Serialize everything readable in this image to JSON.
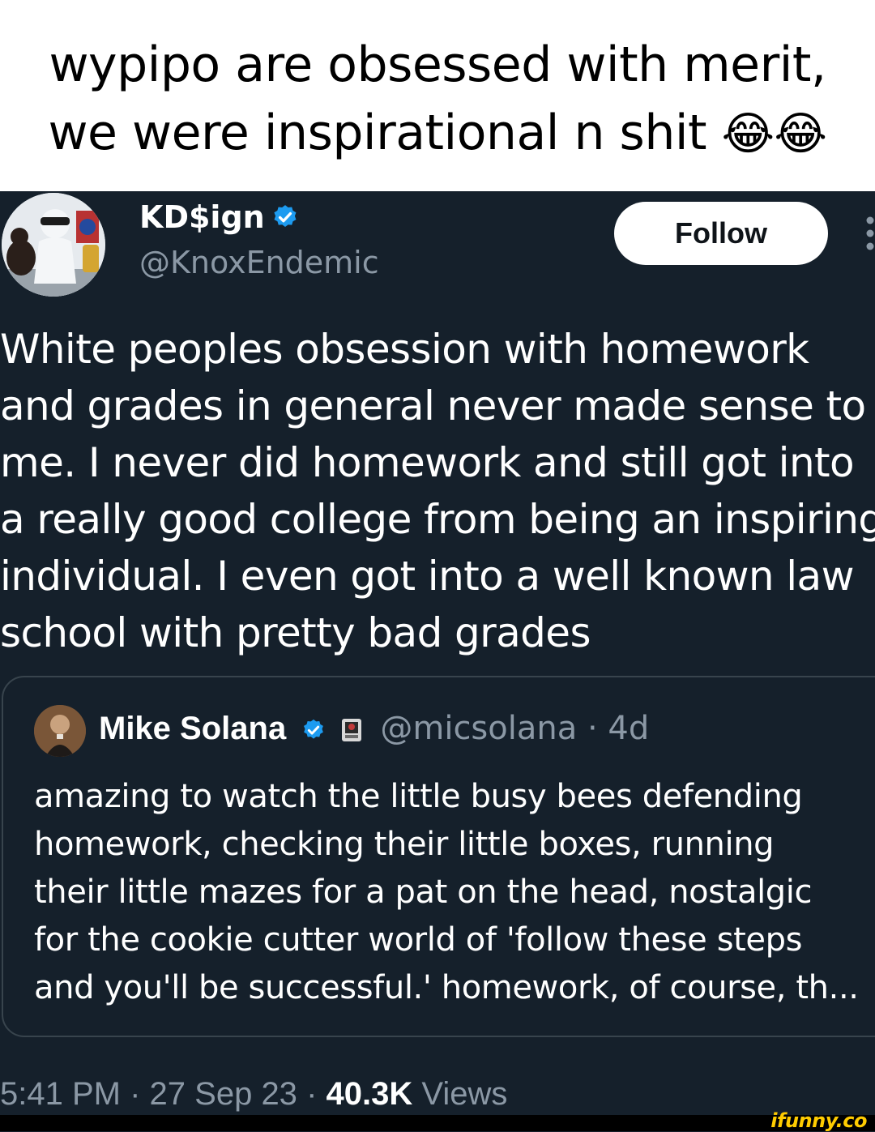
{
  "caption": {
    "line1": "wypipo are obsessed with merit,",
    "line2": "we were inspirational n shit",
    "emoji": "😂😂"
  },
  "tweet": {
    "display_name": "KD$ign",
    "handle": "@KnoxEndemic",
    "follow_label": "Follow",
    "text_lines": [
      "White peoples obsession with homework",
      "and grades in general never made sense to",
      "me. I never did homework and still got into",
      "a really good college from being an inspiring",
      "individual. I even got into a well known  law",
      "school with pretty bad grades"
    ],
    "quote": {
      "display_name": "Mike Solana",
      "handle": "@micsolana",
      "separator": "·",
      "time": "4d",
      "text_lines": [
        "amazing to watch the little busy bees defending",
        "homework, checking their little boxes, running",
        "their little mazes for a pat on the head, nostalgic",
        "for the cookie cutter world of 'follow these steps",
        "and you'll be successful.' homework, of course, th..."
      ]
    },
    "meta": {
      "time": "5:41 PM",
      "date": "27 Sep 23",
      "sep1": "·",
      "sep2": "·",
      "views_count": "40.3K",
      "views_label": "Views"
    }
  },
  "watermark": "ifunny.co",
  "colors": {
    "background": "#15202b",
    "secondary_text": "#8b98a5",
    "verified_blue": "#1d9bf0",
    "border": "#38444d"
  },
  "icons": [
    "verified-badge-icon",
    "more-options-icon",
    "affiliate-badge-icon"
  ]
}
